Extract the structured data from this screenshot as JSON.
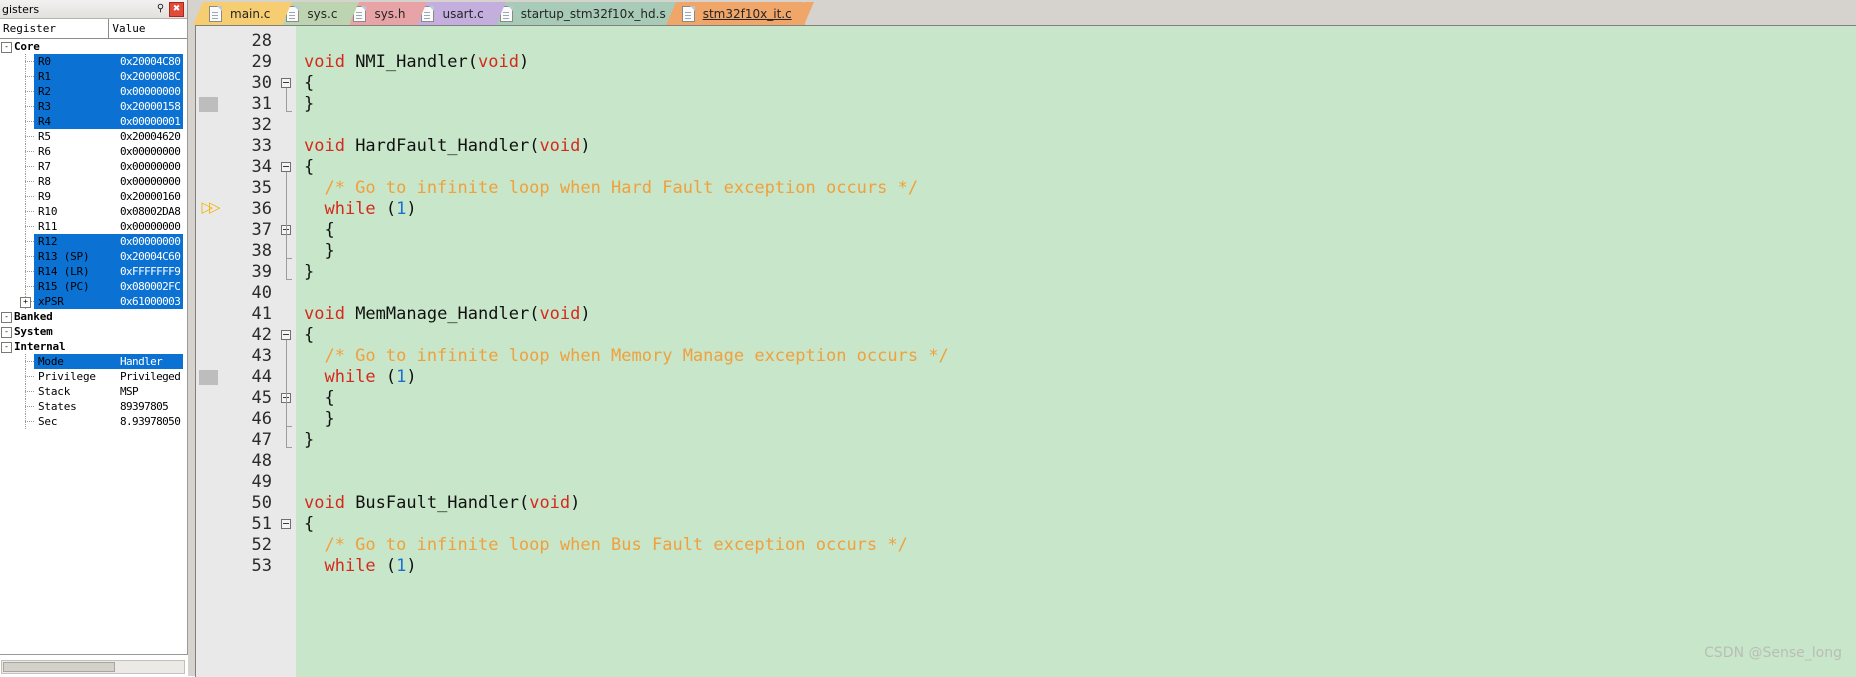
{
  "registers_panel": {
    "title": "gisters",
    "pin_icon": "pin-icon",
    "close_icon": "close-icon",
    "columns": [
      "Register",
      "Value"
    ],
    "rows": [
      {
        "kind": "group",
        "name": "Core",
        "value": "",
        "expander": "-",
        "selected": false
      },
      {
        "kind": "leaf",
        "name": "R0",
        "value": "0x20004C80",
        "selected": true
      },
      {
        "kind": "leaf",
        "name": "R1",
        "value": "0x2000008C",
        "selected": true
      },
      {
        "kind": "leaf",
        "name": "R2",
        "value": "0x00000000",
        "selected": true
      },
      {
        "kind": "leaf",
        "name": "R3",
        "value": "0x20000158",
        "selected": true
      },
      {
        "kind": "leaf",
        "name": "R4",
        "value": "0x00000001",
        "selected": true
      },
      {
        "kind": "leaf",
        "name": "R5",
        "value": "0x20004620",
        "selected": false
      },
      {
        "kind": "leaf",
        "name": "R6",
        "value": "0x00000000",
        "selected": false
      },
      {
        "kind": "leaf",
        "name": "R7",
        "value": "0x00000000",
        "selected": false
      },
      {
        "kind": "leaf",
        "name": "R8",
        "value": "0x00000000",
        "selected": false
      },
      {
        "kind": "leaf",
        "name": "R9",
        "value": "0x20000160",
        "selected": false
      },
      {
        "kind": "leaf",
        "name": "R10",
        "value": "0x08002DA8",
        "selected": false
      },
      {
        "kind": "leaf",
        "name": "R11",
        "value": "0x00000000",
        "selected": false
      },
      {
        "kind": "leaf",
        "name": "R12",
        "value": "0x00000000",
        "selected": true
      },
      {
        "kind": "leaf",
        "name": "R13 (SP)",
        "value": "0x20004C60",
        "selected": true
      },
      {
        "kind": "leaf",
        "name": "R14 (LR)",
        "value": "0xFFFFFFF9",
        "selected": true
      },
      {
        "kind": "leaf",
        "name": "R15 (PC)",
        "value": "0x080002FC",
        "selected": true
      },
      {
        "kind": "leafx",
        "name": "xPSR",
        "value": "0x61000003",
        "expander": "+",
        "selected": true
      },
      {
        "kind": "group",
        "name": "Banked",
        "value": "",
        "expander": "-",
        "selected": false
      },
      {
        "kind": "group",
        "name": "System",
        "value": "",
        "expander": "-",
        "selected": false
      },
      {
        "kind": "group",
        "name": "Internal",
        "value": "",
        "expander": "-",
        "selected": false
      },
      {
        "kind": "leaf",
        "name": "Mode",
        "value": "Handler",
        "selected": true
      },
      {
        "kind": "leaf",
        "name": "Privilege",
        "value": "Privileged",
        "selected": false
      },
      {
        "kind": "leaf",
        "name": "Stack",
        "value": "MSP",
        "selected": false
      },
      {
        "kind": "leaf",
        "name": "States",
        "value": "89397805",
        "selected": false
      },
      {
        "kind": "leaf",
        "name": "Sec",
        "value": "8.93978050",
        "selected": false
      }
    ]
  },
  "tabs": [
    {
      "label": "main.c",
      "color": "#f6cd71",
      "active": false,
      "icon": "document-icon"
    },
    {
      "label": "sys.c",
      "color": "#bcd5b0",
      "active": false,
      "icon": "document-icon"
    },
    {
      "label": "sys.h",
      "color": "#e8a3a6",
      "active": false,
      "icon": "document-icon"
    },
    {
      "label": "usart.c",
      "color": "#c3aede",
      "active": false,
      "icon": "document-icon"
    },
    {
      "label": "startup_stm32f10x_hd.s",
      "color": "#a8cbb8",
      "active": false,
      "icon": "document-icon"
    },
    {
      "label": "stm32f10x_it.c",
      "color": "#f0a569",
      "active": true,
      "icon": "document-icon"
    }
  ],
  "editor": {
    "background": "#c8e6c9",
    "execution_marker": "execution-arrow",
    "lines": [
      {
        "n": "28",
        "tokens": []
      },
      {
        "n": "29",
        "tokens": [
          {
            "t": "void ",
            "c": "kw"
          },
          {
            "t": "NMI_Handler",
            "c": "pl"
          },
          {
            "t": "(",
            "c": "pl"
          },
          {
            "t": "void",
            "c": "kw"
          },
          {
            "t": ")",
            "c": "pl"
          }
        ]
      },
      {
        "n": "30",
        "tokens": [
          {
            "t": "{",
            "c": "pl"
          }
        ],
        "fold": "start"
      },
      {
        "n": "31",
        "tokens": [
          {
            "t": "}",
            "c": "pl"
          }
        ],
        "fold": "end",
        "bp": true
      },
      {
        "n": "32",
        "tokens": []
      },
      {
        "n": "33",
        "tokens": [
          {
            "t": "void ",
            "c": "kw"
          },
          {
            "t": "HardFault_Handler",
            "c": "pl"
          },
          {
            "t": "(",
            "c": "pl"
          },
          {
            "t": "void",
            "c": "kw"
          },
          {
            "t": ")",
            "c": "pl"
          }
        ]
      },
      {
        "n": "34",
        "tokens": [
          {
            "t": "{",
            "c": "pl"
          }
        ],
        "fold": "start"
      },
      {
        "n": "35",
        "tokens": [
          {
            "t": "  /* Go to infinite loop when Hard Fault exception occurs */",
            "c": "cm"
          }
        ]
      },
      {
        "n": "36",
        "tokens": [
          {
            "t": "  ",
            "c": "pl"
          },
          {
            "t": "while ",
            "c": "kw"
          },
          {
            "t": "(",
            "c": "pl"
          },
          {
            "t": "1",
            "c": "num"
          },
          {
            "t": ")",
            "c": "pl"
          }
        ],
        "exec": true
      },
      {
        "n": "37",
        "tokens": [
          {
            "t": "  {",
            "c": "pl"
          }
        ],
        "fold": "start"
      },
      {
        "n": "38",
        "tokens": [
          {
            "t": "  }",
            "c": "pl"
          }
        ],
        "fold": "end"
      },
      {
        "n": "39",
        "tokens": [
          {
            "t": "}",
            "c": "pl"
          }
        ],
        "fold": "end"
      },
      {
        "n": "40",
        "tokens": []
      },
      {
        "n": "41",
        "tokens": [
          {
            "t": "void ",
            "c": "kw"
          },
          {
            "t": "MemManage_Handler",
            "c": "pl"
          },
          {
            "t": "(",
            "c": "pl"
          },
          {
            "t": "void",
            "c": "kw"
          },
          {
            "t": ")",
            "c": "pl"
          }
        ]
      },
      {
        "n": "42",
        "tokens": [
          {
            "t": "{",
            "c": "pl"
          }
        ],
        "fold": "start"
      },
      {
        "n": "43",
        "tokens": [
          {
            "t": "  /* Go to infinite loop when Memory Manage exception occurs */",
            "c": "cm"
          }
        ]
      },
      {
        "n": "44",
        "tokens": [
          {
            "t": "  ",
            "c": "pl"
          },
          {
            "t": "while ",
            "c": "kw"
          },
          {
            "t": "(",
            "c": "pl"
          },
          {
            "t": "1",
            "c": "num"
          },
          {
            "t": ")",
            "c": "pl"
          }
        ],
        "bp": true
      },
      {
        "n": "45",
        "tokens": [
          {
            "t": "  {",
            "c": "pl"
          }
        ],
        "fold": "start"
      },
      {
        "n": "46",
        "tokens": [
          {
            "t": "  }",
            "c": "pl"
          }
        ],
        "fold": "end"
      },
      {
        "n": "47",
        "tokens": [
          {
            "t": "}",
            "c": "pl"
          }
        ],
        "fold": "end"
      },
      {
        "n": "48",
        "tokens": []
      },
      {
        "n": "49",
        "tokens": []
      },
      {
        "n": "50",
        "tokens": [
          {
            "t": "void ",
            "c": "kw"
          },
          {
            "t": "BusFault_Handler",
            "c": "pl"
          },
          {
            "t": "(",
            "c": "pl"
          },
          {
            "t": "void",
            "c": "kw"
          },
          {
            "t": ")",
            "c": "pl"
          }
        ]
      },
      {
        "n": "51",
        "tokens": [
          {
            "t": "{",
            "c": "pl"
          }
        ],
        "fold": "start"
      },
      {
        "n": "52",
        "tokens": [
          {
            "t": "  /* Go to infinite loop when Bus Fault exception occurs */",
            "c": "cm"
          }
        ]
      },
      {
        "n": "53",
        "tokens": [
          {
            "t": "  ",
            "c": "pl"
          },
          {
            "t": "while ",
            "c": "kw"
          },
          {
            "t": "(",
            "c": "pl"
          },
          {
            "t": "1",
            "c": "num"
          },
          {
            "t": ")",
            "c": "pl"
          }
        ]
      }
    ]
  },
  "watermark": "CSDN @Sense_long"
}
